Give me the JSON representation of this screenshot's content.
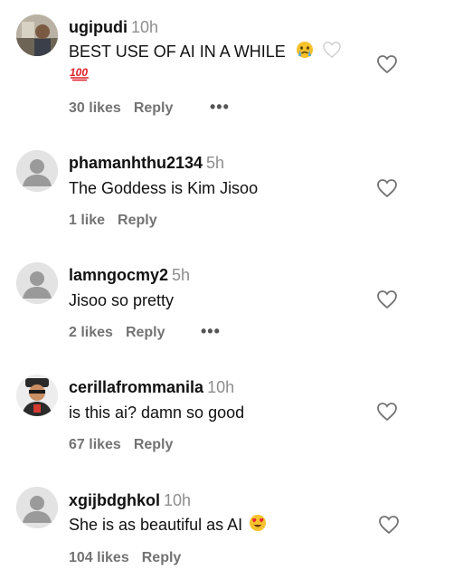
{
  "comments": [
    {
      "username": "ugipudi",
      "time": "10h",
      "text": "BEST USE OF AI IN A WHILE",
      "extra_emoji": "100",
      "likes": "30 likes",
      "reply": "Reply",
      "more": "•••",
      "avatar": "photo"
    },
    {
      "username": "phamanhthu2134",
      "time": "5h",
      "text": "The Goddess is Kim Jisoo",
      "likes": "1 like",
      "reply": "Reply",
      "avatar": "default"
    },
    {
      "username": "lamngocmy2",
      "time": "5h",
      "text": "Jisoo so pretty",
      "likes": "2 likes",
      "reply": "Reply",
      "more": "•••",
      "avatar": "default"
    },
    {
      "username": "cerillafrommanila",
      "time": "10h",
      "text": "is this ai? damn so good",
      "likes": "67 likes",
      "reply": "Reply",
      "avatar": "photo"
    },
    {
      "username": "xgijbdghkol",
      "time": "10h",
      "text": "She is as beautiful as AI",
      "likes": "104 likes",
      "reply": "Reply",
      "avatar": "default"
    }
  ],
  "icons": {
    "like": "heart-outline-icon",
    "more": "more-options-icon",
    "default_avatar": "default-avatar-icon"
  }
}
